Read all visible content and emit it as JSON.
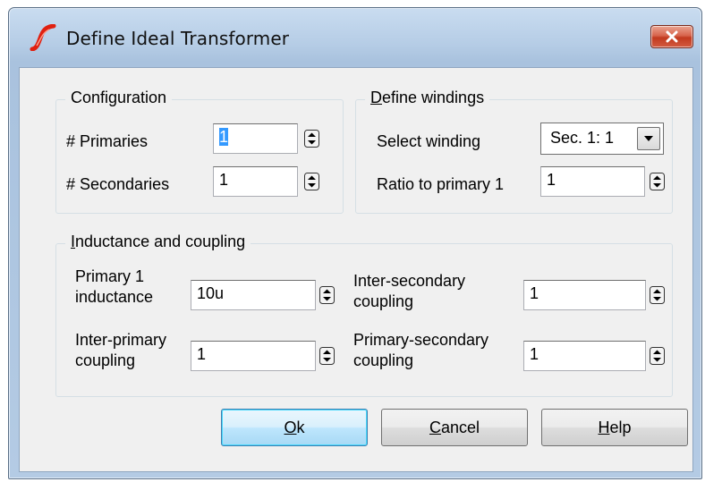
{
  "window": {
    "title": "Define Ideal Transformer"
  },
  "configuration": {
    "heading": "Configuration",
    "primaries_label": "# Primaries",
    "primaries_value": "1",
    "secondaries_label": "# Secondaries",
    "secondaries_value": "1"
  },
  "windings": {
    "heading_accel": "D",
    "heading_rest": "efine windings",
    "select_label": "Select winding",
    "select_value": "Sec. 1: 1",
    "ratio_label": "Ratio to primary 1",
    "ratio_value": "1"
  },
  "inductance": {
    "heading_accel": "I",
    "heading_rest": "nductance and coupling",
    "primary_inductance_label_1": "Primary 1",
    "primary_inductance_label_2": "inductance",
    "primary_inductance_value": "10u",
    "inter_primary_label_1": "Inter-primary",
    "inter_primary_label_2": "coupling",
    "inter_primary_value": "1",
    "inter_secondary_label_1": "Inter-secondary",
    "inter_secondary_label_2": "coupling",
    "inter_secondary_value": "1",
    "primary_secondary_label_1": "Primary-secondary",
    "primary_secondary_label_2": "coupling",
    "primary_secondary_value": "1"
  },
  "buttons": {
    "ok_accel": "O",
    "ok_rest": "k",
    "cancel_accel": "C",
    "cancel_rest": "ancel",
    "help_accel": "H",
    "help_rest": "elp"
  },
  "icons": {
    "app": "simetrix-logo-icon",
    "close": "close-icon",
    "spin": "spin-arrows-icon",
    "dropdown": "chevron-down-icon"
  },
  "colors": {
    "close_button": "#c23a1f",
    "default_button_border": "#3c7fb1",
    "selection": "#3399ff",
    "logo": "#e02010"
  }
}
